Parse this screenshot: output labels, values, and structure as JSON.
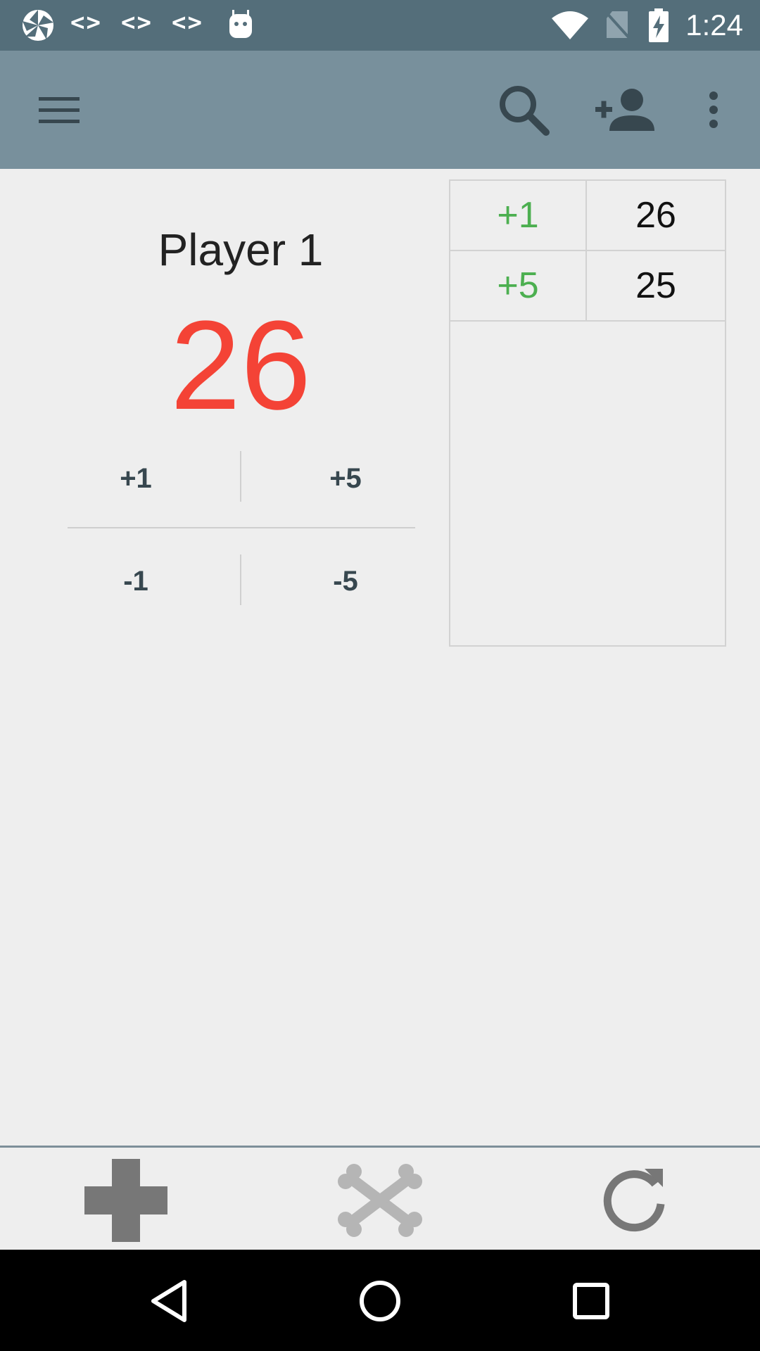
{
  "status_bar": {
    "time": "1:24",
    "code_glyph": "<>",
    "icons": [
      "pinwheel-icon",
      "code-icon",
      "code-icon",
      "code-icon",
      "android-icon",
      "wifi-icon",
      "no-sim-icon",
      "battery-charging-icon"
    ]
  },
  "app_bar": {
    "icons": [
      "menu-icon",
      "search-icon",
      "add-person-icon",
      "more-vert-icon"
    ]
  },
  "player": {
    "name": "Player 1",
    "score": "26"
  },
  "score_buttons": {
    "plus_one": "+1",
    "plus_five": "+5",
    "minus_one": "-1",
    "minus_five": "-5"
  },
  "history": {
    "rows": [
      {
        "delta": "+1",
        "total": "26"
      },
      {
        "delta": "+5",
        "total": "25"
      }
    ]
  },
  "bottom_bar": {
    "icons": [
      "add-icon",
      "crossbones-icon",
      "refresh-icon"
    ]
  },
  "nav_bar": {
    "icons": [
      "back-icon",
      "home-icon",
      "recents-icon"
    ]
  },
  "colors": {
    "status_bar": "#546e7a",
    "app_bar": "#78909c",
    "score": "#f44336",
    "positive_delta": "#4caf50"
  }
}
